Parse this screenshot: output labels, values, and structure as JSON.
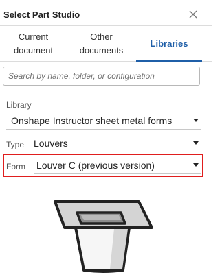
{
  "dialog": {
    "title": "Select Part Studio"
  },
  "tabs": [
    {
      "line1": "Current",
      "line2": "document"
    },
    {
      "line1": "Other",
      "line2": "documents"
    },
    {
      "label": "Libraries"
    }
  ],
  "search": {
    "placeholder": "Search by name, folder, or configuration",
    "value": ""
  },
  "library": {
    "label": "Library",
    "value": "Onshape Instructor sheet metal forms"
  },
  "type": {
    "label": "Type",
    "value": "Louvers"
  },
  "form": {
    "label": "Form",
    "value": "Louver C (previous version)"
  },
  "colors": {
    "accent": "#1f5fa8",
    "highlight": "#e01e1e"
  },
  "icons": {
    "close": "close-icon",
    "dropdown": "chevron-down-icon",
    "preview": "louver-form-preview"
  }
}
